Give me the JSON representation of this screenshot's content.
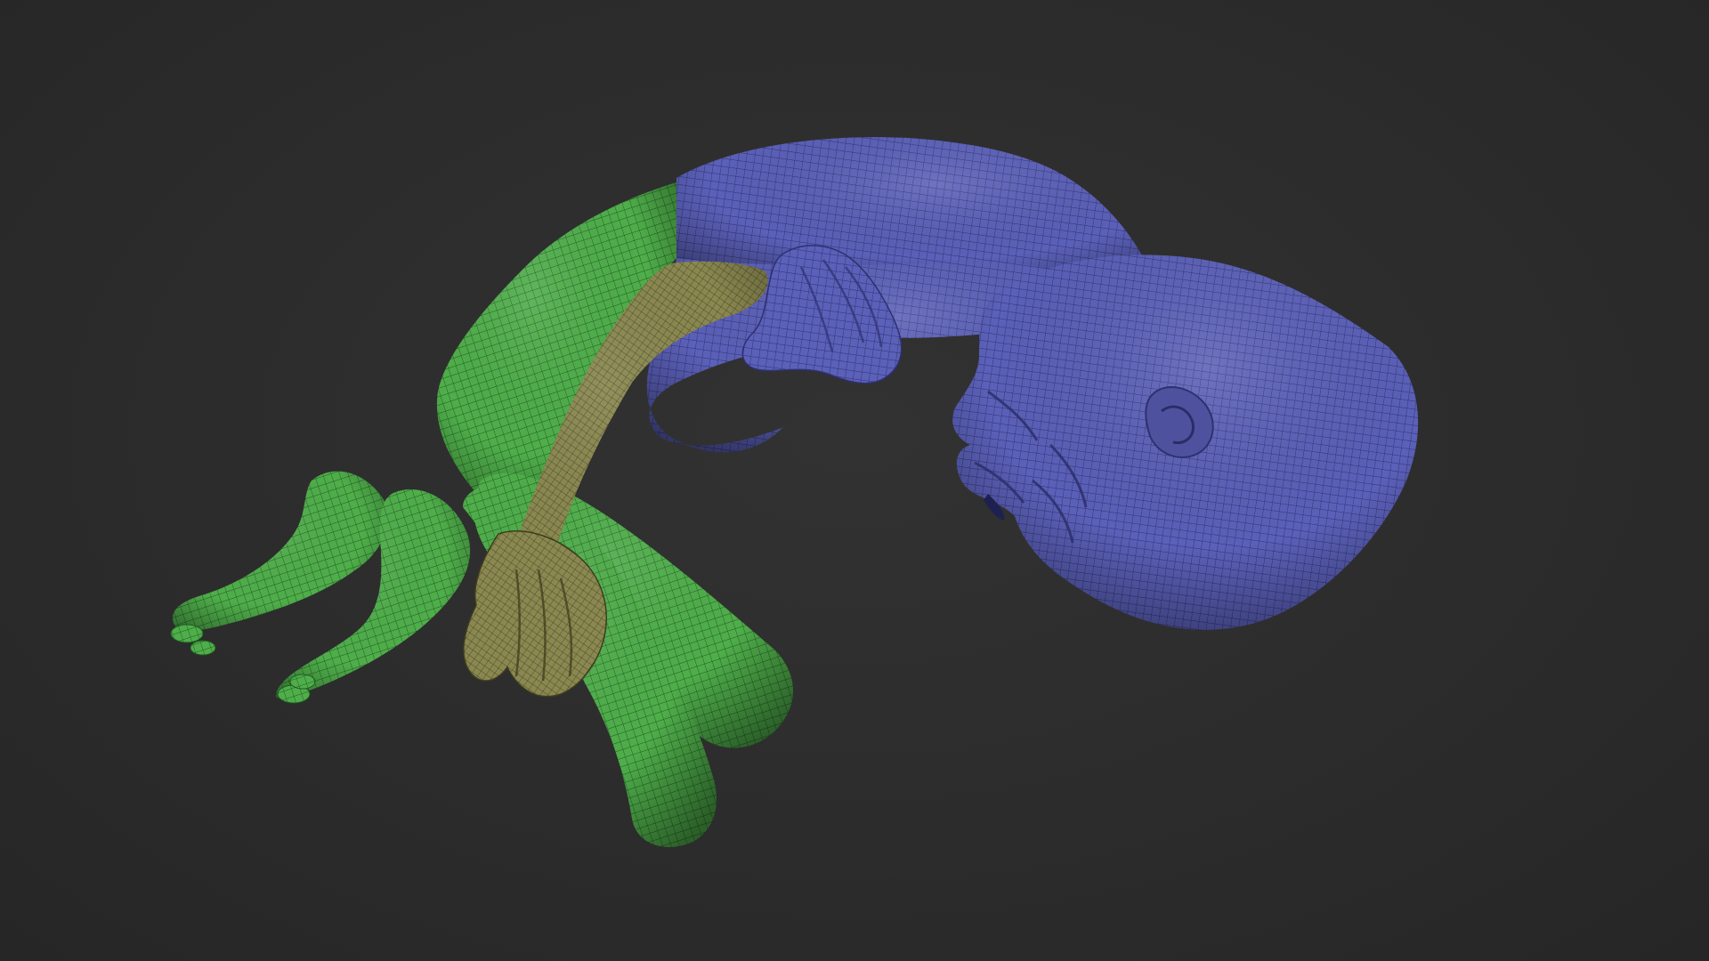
{
  "scene": {
    "background_color": "#2b2b2b",
    "subject": "curled-human-sculpt",
    "polygroup_colors": {
      "body_blue": "#5a5fb4",
      "legs_green": "#4fae4a",
      "arm_olive": "#8c8a50"
    },
    "wireframe_visible": true
  }
}
